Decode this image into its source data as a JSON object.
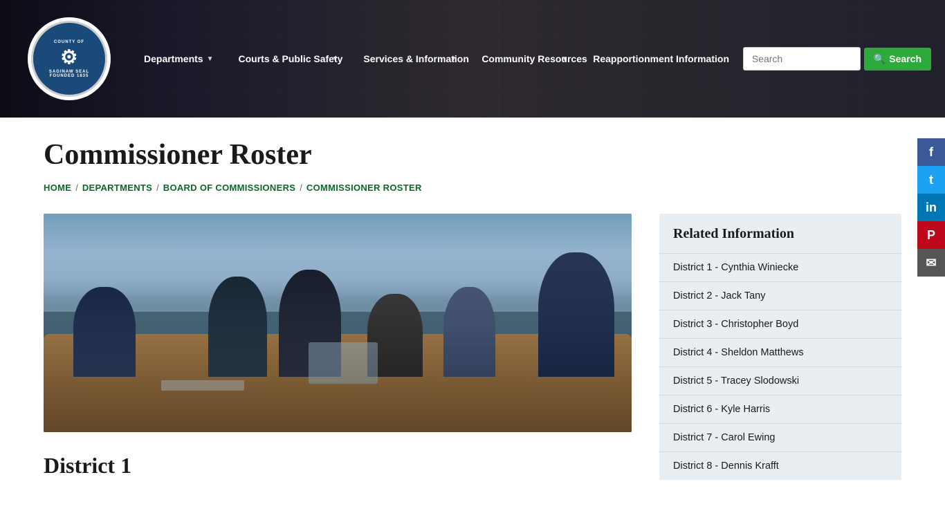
{
  "header": {
    "logo_text": "COUNTY OF SAGINAW SEAL",
    "logo_founded": "FOUNDED 1835",
    "nav_items": [
      {
        "label": "Departments",
        "has_arrow": true
      },
      {
        "label": "Courts & Public Safety",
        "has_arrow": true
      },
      {
        "label": "Services & Information",
        "has_arrow": true
      },
      {
        "label": "Community Resources",
        "has_arrow": true
      },
      {
        "label": "Reapportionment Information",
        "has_arrow": false
      }
    ],
    "search_placeholder": "Search",
    "search_button_label": "Search"
  },
  "breadcrumb": {
    "items": [
      {
        "label": "HOME",
        "active": true
      },
      {
        "label": "DEPARTMENTS",
        "active": true
      },
      {
        "label": "BOARD OF COMMISSIONERS",
        "active": true
      },
      {
        "label": "COMMISSIONER ROSTER",
        "active": false
      }
    ]
  },
  "page_title": "Commissioner Roster",
  "district_heading": "District 1",
  "related_info": {
    "title": "Related Information",
    "items": [
      "District 1 - Cynthia Winiecke",
      "District 2 - Jack Tany",
      "District 3 - Christopher Boyd",
      "District 4 - Sheldon Matthews",
      "District 5 - Tracey Slodowski",
      "District 6 - Kyle Harris",
      "District 7 - Carol Ewing",
      "District 8 - Dennis Krafft"
    ]
  },
  "social": {
    "facebook_label": "f",
    "twitter_label": "t",
    "linkedin_label": "in",
    "pinterest_label": "P",
    "email_label": "✉"
  }
}
